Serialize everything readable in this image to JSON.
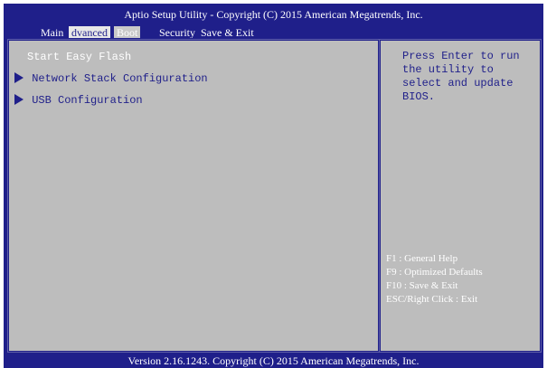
{
  "header": {
    "title": "Aptio Setup Utility - Copyright (C) 2015 American Megatrends, Inc.",
    "tabs": [
      {
        "label": "Main"
      },
      {
        "label": "dvanced"
      },
      {
        "label": "Boot"
      },
      {
        "label": "Security"
      },
      {
        "label": "Save & Exit"
      }
    ]
  },
  "menu": {
    "items": [
      {
        "label": "Start Easy Flash"
      },
      {
        "label": "Network Stack Configuration"
      },
      {
        "label": "USB Configuration"
      }
    ]
  },
  "help": {
    "text": "Press Enter to run\nthe utility to\nselect and update\nBIOS."
  },
  "keys": [
    {
      "text": "F1  : General Help"
    },
    {
      "text": "F9  : Optimized Defaults"
    },
    {
      "text": "F10  : Save & Exit"
    },
    {
      "text": "ESC/Right Click  : Exit"
    }
  ],
  "footer": {
    "text": "Version 2.16.1243. Copyright (C) 2015 American Megatrends, Inc."
  },
  "colors": {
    "frame_blue": "#1f1f8a",
    "panel_gray": "#bdbdbd",
    "text_white": "#ffffff"
  }
}
